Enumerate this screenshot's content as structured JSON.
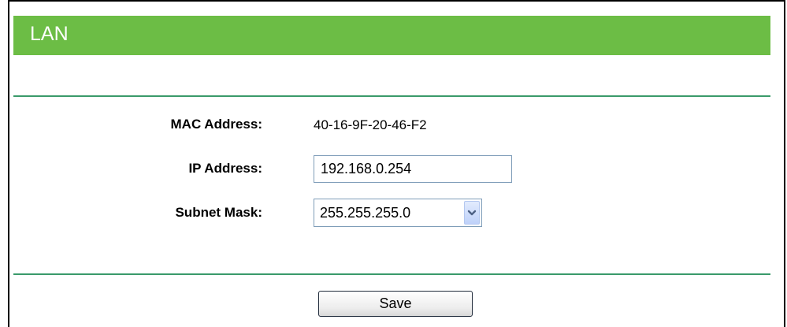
{
  "section": {
    "title": "LAN"
  },
  "fields": {
    "mac": {
      "label": "MAC Address:",
      "value": "40-16-9F-20-46-F2"
    },
    "ip": {
      "label": "IP Address:",
      "value": "192.168.0.254"
    },
    "subnet": {
      "label": "Subnet Mask:",
      "selected": "255.255.255.0",
      "arrow_icon": "chevron-down-icon"
    }
  },
  "actions": {
    "save_label": "Save"
  },
  "colors": {
    "header_bg": "#6cbd45",
    "divider": "#3a9a6a",
    "input_border": "#7f9db9"
  }
}
